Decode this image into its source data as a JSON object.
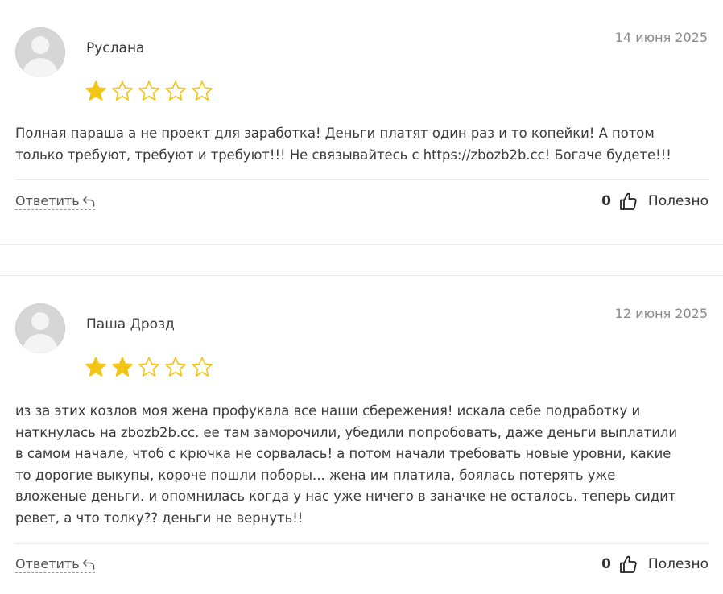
{
  "reviews": [
    {
      "author": "Руслана",
      "date": "14 июня 2025",
      "rating": 1,
      "max_rating": 5,
      "lines": [
        "Полная параша а не проект для заработка! Деньги платят один раз и то копейки! А потом",
        "только требуют, требуют и требуют!!! Не связывайтесь с https://zbozb2b.cc! Богаче будете!!!"
      ],
      "reply_label": "Ответить",
      "useful_count": "0",
      "useful_label": "Полезно"
    },
    {
      "author": "Паша Дрозд",
      "date": "12 июня 2025",
      "rating": 2,
      "max_rating": 5,
      "lines": [
        "из за этих козлов моя жена профукала все наши сбережения! искала себе подработку и",
        "наткнулась на zbozb2b.cc. ее там заморочили, убедили попробовать, даже деньги выплатили",
        "в самом начале, чтоб с крючка не сорвалась! а потом начали требовать новые уровни, какие",
        "то дорогие выкупы, короче пошли поборы... жена им платила, боялась потерять уже",
        "вложеные деньги. и опомнилась когда у нас уже ничего в заначке не осталось. теперь сидит",
        "ревет, а что толку?? деньги не вернуть!!"
      ],
      "reply_label": "Ответить",
      "useful_count": "0",
      "useful_label": "Полезно"
    }
  ],
  "colors": {
    "star_filled": "#F2C414",
    "star_empty_stroke": "#F2C414",
    "text": "#3A3A3A",
    "date": "#8A8A8A",
    "separator": "#E9E9E9"
  },
  "icons": {
    "reply": "reply-arrow-icon",
    "useful": "thumbs-up-icon",
    "star": "star-icon",
    "avatar": "user-placeholder-icon"
  }
}
